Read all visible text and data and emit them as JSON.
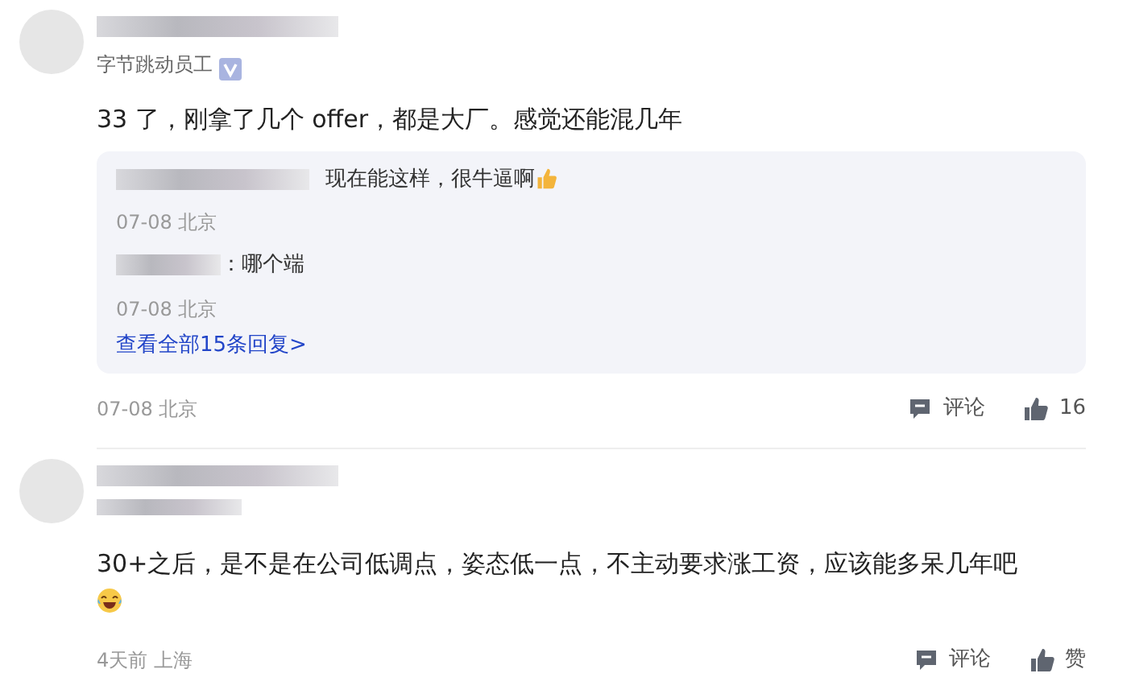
{
  "comments": [
    {
      "author": {
        "subtitle": "字节跳动员工",
        "verified": true
      },
      "text": "33 了，刚拿了几个 offer，都是大厂。感觉还能混几年",
      "text_emoji": false,
      "replies": [
        {
          "text": "现在能这样，很牛逼啊",
          "emoji": true,
          "meta": "07-08 北京"
        },
        {
          "text": "：哪个端",
          "emoji": false,
          "meta": "07-08 北京"
        }
      ],
      "more_replies": "查看全部15条回复>",
      "meta": "07-08 北京",
      "comment_label": "评论",
      "like_label": "16"
    },
    {
      "author": {
        "verified": false
      },
      "text": "30+之后，是不是在公司低调点，姿态低一点，不主动要求涨工资，应该能多呆几年吧",
      "text_emoji": true,
      "meta": "4天前 上海",
      "comment_label": "评论",
      "like_label": "赞"
    }
  ]
}
